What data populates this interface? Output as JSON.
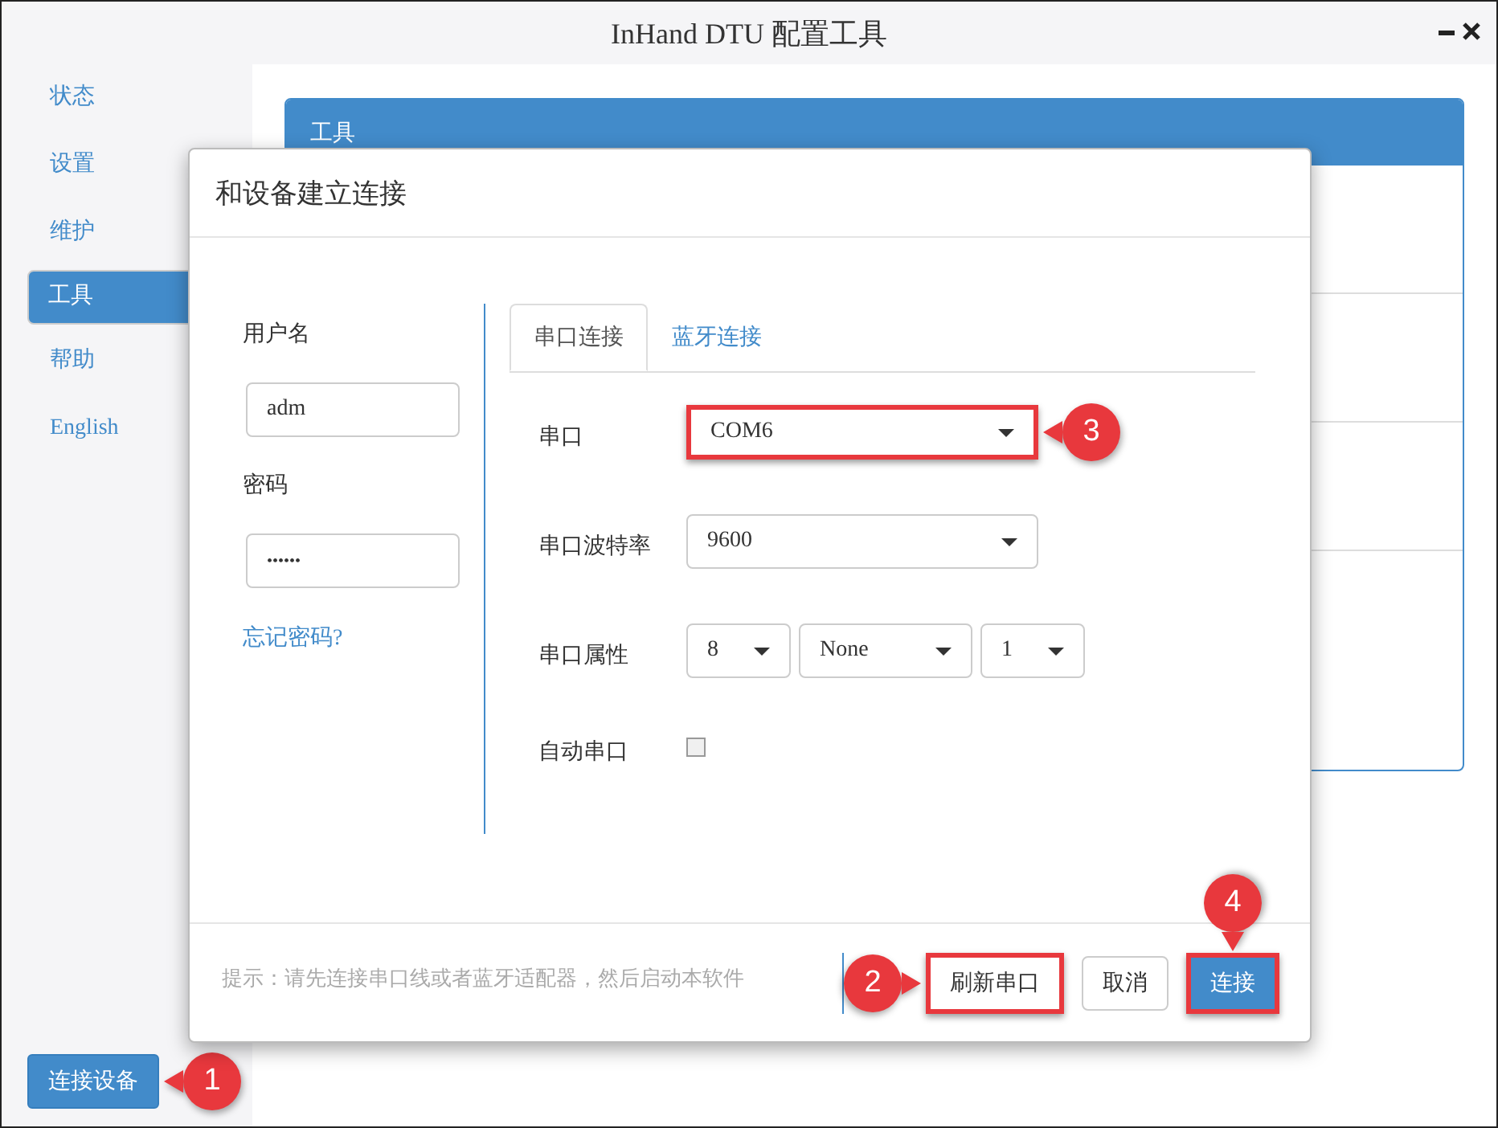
{
  "window": {
    "title": "InHand DTU 配置工具"
  },
  "sidebar": {
    "items": [
      {
        "label": "状态",
        "selected": false
      },
      {
        "label": "设置",
        "selected": false
      },
      {
        "label": "维护",
        "selected": false
      },
      {
        "label": "工具",
        "selected": true
      },
      {
        "label": "帮助",
        "selected": false
      },
      {
        "label": "English",
        "selected": false
      }
    ],
    "connect_button": {
      "label": "连接设备",
      "callout": {
        "number": "1",
        "kind": "right"
      }
    }
  },
  "panel": {
    "title": "工具"
  },
  "dialog": {
    "title": "和设备建立连接",
    "login": {
      "username_label": "用户名",
      "username": "adm",
      "password_label": "密码",
      "password": "••••••",
      "forgot_link": "忘记密码?"
    },
    "tabs": [
      {
        "label": "串口连接",
        "selected": true
      },
      {
        "label": "蓝牙连接",
        "selected": false
      }
    ],
    "fields": [
      {
        "kind": "select",
        "label": "串口",
        "selects": [
          {
            "value": "COM6",
            "highlighted": true,
            "callout": {
              "number": "3",
              "kind": "right"
            }
          }
        ]
      },
      {
        "kind": "select",
        "label": "串口波特率",
        "selects": [
          {
            "value": "9600",
            "highlighted": false
          }
        ]
      },
      {
        "kind": "select",
        "label": "串口属性",
        "selects": [
          {
            "value": "8",
            "highlighted": false
          },
          {
            "value": "None",
            "highlighted": false
          },
          {
            "value": "1",
            "highlighted": false
          }
        ]
      },
      {
        "kind": "checkbox",
        "label": "自动串口",
        "checked": false
      }
    ],
    "hint": "提示：请先连接串口线或者蓝牙适配器，然后启动本软件",
    "buttons": [
      {
        "label": "刷新串口",
        "kind": "default",
        "highlighted": true,
        "callout": {
          "number": "2",
          "kind": "left"
        }
      },
      {
        "label": "取消",
        "kind": "default",
        "highlighted": false
      },
      {
        "label": "连接",
        "kind": "primary",
        "highlighted": true,
        "callout": {
          "number": "4",
          "kind": "top"
        }
      }
    ]
  }
}
